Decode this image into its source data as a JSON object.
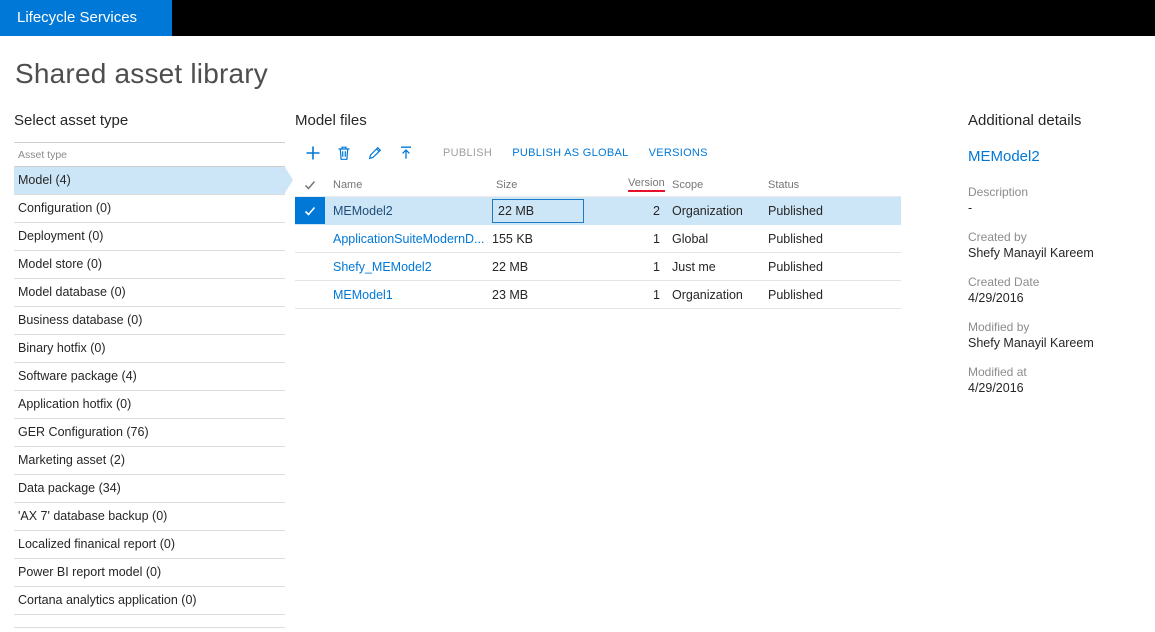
{
  "topbar": {
    "brand": "Lifecycle Services"
  },
  "page_title": "Shared asset library",
  "sidebar": {
    "heading": "Select asset type",
    "column_label": "Asset type",
    "items": [
      {
        "label": "Model (4)",
        "selected": true
      },
      {
        "label": "Configuration (0)",
        "selected": false
      },
      {
        "label": "Deployment (0)",
        "selected": false
      },
      {
        "label": "Model store (0)",
        "selected": false
      },
      {
        "label": "Model database (0)",
        "selected": false
      },
      {
        "label": "Business database (0)",
        "selected": false
      },
      {
        "label": "Binary hotfix (0)",
        "selected": false
      },
      {
        "label": "Software package (4)",
        "selected": false
      },
      {
        "label": "Application hotfix (0)",
        "selected": false
      },
      {
        "label": "GER Configuration (76)",
        "selected": false
      },
      {
        "label": "Marketing asset (2)",
        "selected": false
      },
      {
        "label": "Data package (34)",
        "selected": false
      },
      {
        "label": "'AX 7' database backup (0)",
        "selected": false
      },
      {
        "label": "Localized finanical report (0)",
        "selected": false
      },
      {
        "label": "Power BI report model (0)",
        "selected": false
      },
      {
        "label": "Cortana analytics application (0)",
        "selected": false
      }
    ]
  },
  "main": {
    "heading": "Model files",
    "toolbar": {
      "icons": [
        "add-icon",
        "delete-icon",
        "edit-icon",
        "upload-icon"
      ],
      "publish": "PUBLISH",
      "publish_as_global": "PUBLISH AS GLOBAL",
      "versions": "VERSIONS"
    },
    "table": {
      "headers": {
        "name": "Name",
        "size": "Size",
        "version": "Version",
        "scope": "Scope",
        "status": "Status"
      },
      "rows": [
        {
          "name": "MEModel2",
          "size": "22 MB",
          "version": "2",
          "scope": "Organization",
          "status": "Published",
          "selected": true
        },
        {
          "name": "ApplicationSuiteModernD...",
          "size": "155 KB",
          "version": "1",
          "scope": "Global",
          "status": "Published",
          "selected": false
        },
        {
          "name": "Shefy_MEModel2",
          "size": "22 MB",
          "version": "1",
          "scope": "Just me",
          "status": "Published",
          "selected": false
        },
        {
          "name": "MEModel1",
          "size": "23 MB",
          "version": "1",
          "scope": "Organization",
          "status": "Published",
          "selected": false
        }
      ]
    }
  },
  "details": {
    "heading": "Additional details",
    "title": "MEModel2",
    "fields": [
      {
        "label": "Description",
        "value": "-"
      },
      {
        "label": "Created by",
        "value": "Shefy Manayil Kareem"
      },
      {
        "label": "Created Date",
        "value": "4/29/2016"
      },
      {
        "label": "Modified by",
        "value": "Shefy Manayil Kareem"
      },
      {
        "label": "Modified at",
        "value": "4/29/2016"
      }
    ]
  },
  "colors": {
    "accent": "#0078d7",
    "selection": "#cde6f7",
    "annotation_red": "#e8112d"
  }
}
